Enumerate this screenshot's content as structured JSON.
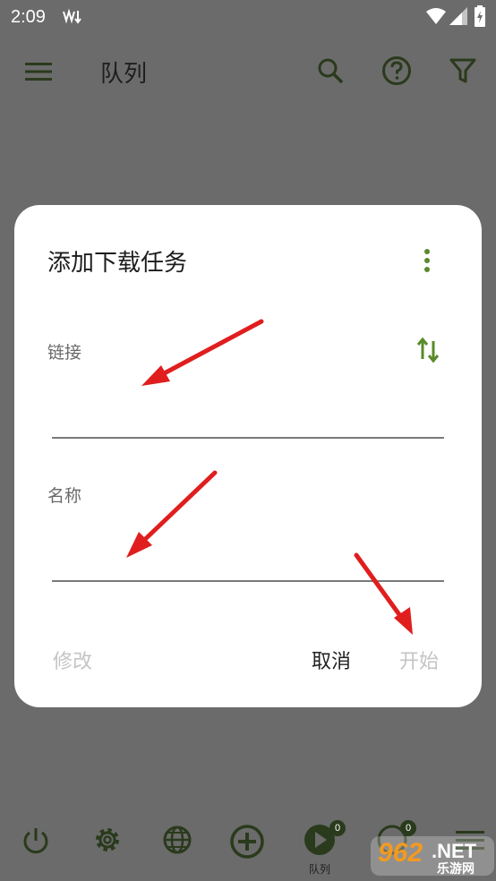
{
  "status_bar": {
    "time": "2:09"
  },
  "app_bar": {
    "title": "队列"
  },
  "dialog": {
    "title": "添加下载任务",
    "link_label": "链接",
    "link_value": "",
    "name_label": "名称",
    "name_value": "",
    "edit_button": "修改",
    "cancel_button": "取消",
    "start_button": "开始"
  },
  "bottom_nav": {
    "queue_label": "队列",
    "queue_badge": "0",
    "completed_badge": "0"
  },
  "watermark": {
    "text": "乐游网"
  },
  "colors": {
    "accent": "#5a8a2a",
    "overlay": "#6b6b6b",
    "dark_icon": "#2a3a1c",
    "annotation_arrow": "#e01e1e"
  }
}
